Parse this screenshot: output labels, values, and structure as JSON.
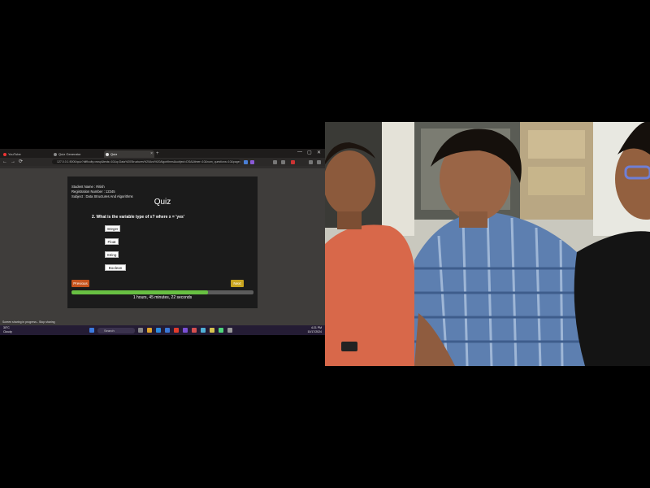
{
  "browser": {
    "tabs": [
      {
        "label": "YouTube"
      },
      {
        "label": "Quiz Generator"
      },
      {
        "label": "Quiz"
      }
    ],
    "new_tab": "+",
    "url": "127.0.0.1:5000/quiz?difficulty=easy&tests=10&q=Data%20Structures%20And%20Algorithms&subject=DSA&timer=10&num_questions=10&page=2",
    "window_controls": [
      "—",
      "▢",
      "✕"
    ],
    "nav": [
      "←",
      "→",
      "⟳"
    ]
  },
  "quiz": {
    "student_name_label": "Student Name : Ritish",
    "registration_label": "Registration Number : 12345",
    "subject_label": "Subject : Data Structures And Algorithms",
    "title": "Quiz",
    "question": "2. What is the variable type of x? where x = 'yes'",
    "options": [
      "Integer",
      "Float",
      "String",
      "Boolean"
    ],
    "previous_label": "Previous",
    "next_label": "Next",
    "progress": 0.75,
    "timer_text": "1 hours, 45 minutes, 22 seconds",
    "colors": {
      "previous": "#c6531d",
      "next": "#c8a41f",
      "progress": "#68c042"
    }
  },
  "desktop": {
    "notification": "Screen sharing in progress - Stop sharing",
    "weather_temp": "30°C",
    "weather_desc": "Cloudy",
    "search_placeholder": "Search",
    "time": "4:21 PM",
    "date": "10/17/2024"
  }
}
